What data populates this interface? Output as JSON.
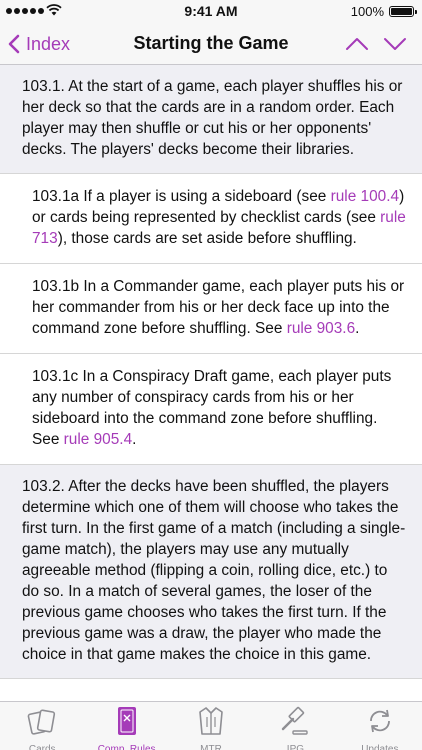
{
  "status": {
    "time": "9:41 AM",
    "battery": "100%",
    "battery_level": 1.0
  },
  "nav": {
    "back_label": "Index",
    "title": "Starting the Game"
  },
  "colors": {
    "accent": "#a53bb8",
    "main_bg": "#efeff4",
    "sub_bg": "#ffffff"
  },
  "rules": [
    {
      "type": "main",
      "parts": [
        {
          "text": "103.1. At the start of a game, each player shuffles his or her deck so that the cards are in a random order. Each player may then shuffle or cut his or her opponents' decks. The players' decks become their libraries."
        }
      ]
    },
    {
      "type": "sub",
      "parts": [
        {
          "text": "103.1a If a player is using a sideboard (see "
        },
        {
          "link": "rule 100.4"
        },
        {
          "text": ") or cards being represented by checklist cards (see "
        },
        {
          "link": "rule 713"
        },
        {
          "text": "), those cards are set aside before shuffling."
        }
      ]
    },
    {
      "type": "sub",
      "parts": [
        {
          "text": "103.1b In a Commander game, each player puts his or her commander from his or her deck face up into the command zone before shuffling. See "
        },
        {
          "link": "rule 903.6"
        },
        {
          "text": "."
        }
      ]
    },
    {
      "type": "sub",
      "parts": [
        {
          "text": "103.1c In a Conspiracy Draft game, each player puts any number of conspiracy cards from his or her sideboard into the command zone before shuffling. See "
        },
        {
          "link": "rule 905.4"
        },
        {
          "text": "."
        }
      ]
    },
    {
      "type": "main",
      "parts": [
        {
          "text": "103.2. After the decks have been shuffled, the players determine which one of them will choose who takes the first turn. In the first game of a match (including a single-game match), the players may use any mutually agreeable method (flipping a coin, rolling dice, etc.) to do so. In a match of several games, the loser of the previous game chooses who takes the first turn. If the previous game was a draw, the player who made the choice in that game makes the choice in this game."
        }
      ]
    }
  ],
  "tabs": [
    {
      "label": "Cards",
      "icon": "cards-icon",
      "active": false
    },
    {
      "label": "Comp. Rules",
      "icon": "rulebook-icon",
      "active": true
    },
    {
      "label": "MTR",
      "icon": "jacket-icon",
      "active": false
    },
    {
      "label": "IPG",
      "icon": "gavel-icon",
      "active": false
    },
    {
      "label": "Updates",
      "icon": "refresh-icon",
      "active": false
    }
  ]
}
